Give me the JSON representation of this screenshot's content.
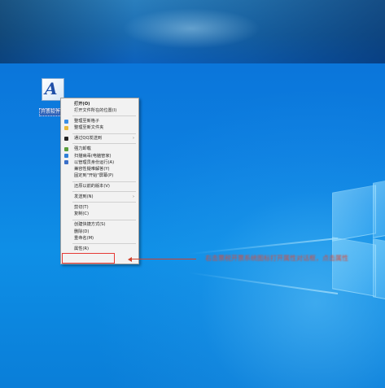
{
  "desktop": {
    "icon": {
      "glyph": "A",
      "label": "开票软件系统"
    }
  },
  "context_menu": {
    "items": [
      {
        "label": "打开(O)",
        "bold": true,
        "icon": null,
        "submenu": false
      },
      {
        "label": "打开文件所在的位置(I)",
        "bold": false,
        "icon": null,
        "submenu": false
      },
      {
        "separator": true
      },
      {
        "label": "整理至新格子",
        "bold": false,
        "icon": "fence-icon",
        "icon_color": "#3a8ee6",
        "submenu": false
      },
      {
        "label": "整理至新文件夹",
        "bold": false,
        "icon": "folder-icon",
        "icon_color": "#e8b93a",
        "submenu": false
      },
      {
        "separator": true
      },
      {
        "label": "通过QQ发送到",
        "bold": false,
        "icon": "qq-icon",
        "icon_color": "#222222",
        "submenu": true
      },
      {
        "separator": true
      },
      {
        "label": "强力卸载",
        "bold": false,
        "icon": "uninstall-icon",
        "icon_color": "#5a9e3a",
        "submenu": false
      },
      {
        "label": "扫描病毒(电脑管家)",
        "bold": false,
        "icon": "antivirus-icon",
        "icon_color": "#2f7fd8",
        "submenu": false
      },
      {
        "label": "以管理员身份运行(A)",
        "bold": false,
        "icon": "admin-shield-icon",
        "icon_color": "#3a6fc8",
        "submenu": false
      },
      {
        "label": "兼容性疑难解答(Y)",
        "bold": false,
        "icon": null,
        "submenu": false
      },
      {
        "label": "固定到\"开始\"屏幕(P)",
        "bold": false,
        "icon": null,
        "submenu": false
      },
      {
        "separator": true
      },
      {
        "label": "还原以前的版本(V)",
        "bold": false,
        "icon": null,
        "submenu": false
      },
      {
        "separator": true
      },
      {
        "label": "发送到(N)",
        "bold": false,
        "icon": null,
        "submenu": true
      },
      {
        "separator": true
      },
      {
        "label": "剪切(T)",
        "bold": false,
        "icon": null,
        "submenu": false
      },
      {
        "label": "复制(C)",
        "bold": false,
        "icon": null,
        "submenu": false
      },
      {
        "separator": true
      },
      {
        "label": "创建快捷方式(S)",
        "bold": false,
        "icon": null,
        "submenu": false
      },
      {
        "label": "删除(D)",
        "bold": false,
        "icon": null,
        "submenu": false
      },
      {
        "label": "重命名(M)",
        "bold": false,
        "icon": null,
        "submenu": false
      },
      {
        "separator": true
      },
      {
        "label": "属性(R)",
        "bold": false,
        "icon": null,
        "submenu": false
      }
    ],
    "submenu_arrow": "›"
  },
  "annotation": {
    "text": "右击票税开票系统图标打开属性对话框，点击属性",
    "color": "#d84a3a"
  },
  "colors": {
    "desktop_blue": "#0c7fe0",
    "menu_background": "#f2f2f2",
    "highlight_red": "#e53935",
    "arrow_red": "#d0402c"
  }
}
